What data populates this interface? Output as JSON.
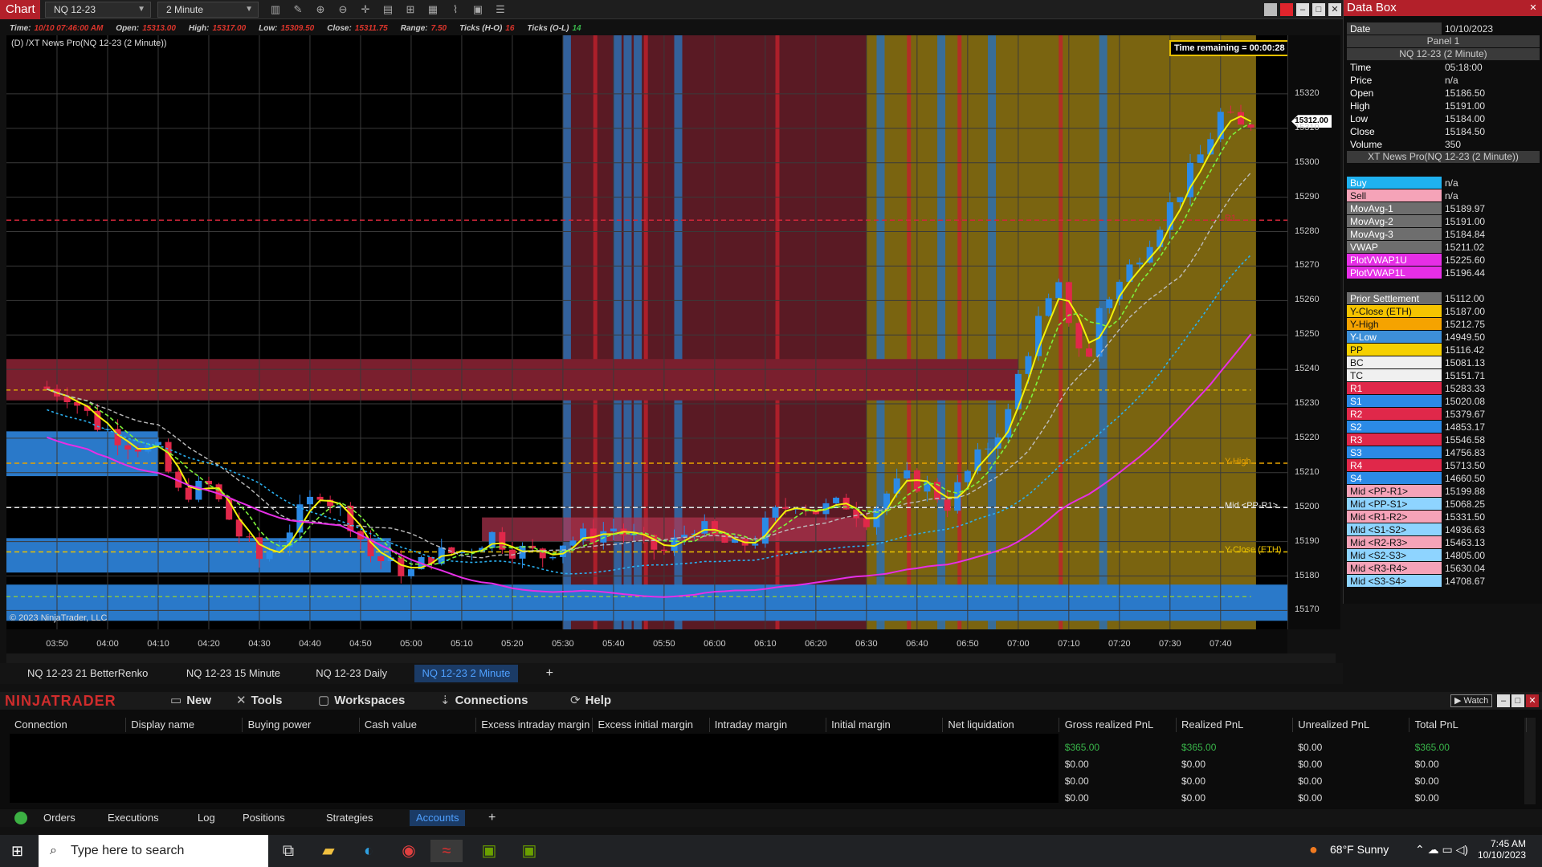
{
  "toolbar": {
    "chart_tag": "Chart",
    "instrument": "NQ 12-23",
    "interval": "2 Minute"
  },
  "infobar": {
    "items": [
      {
        "label": "Time:",
        "value": "10/10 07:46:00 AM",
        "cls": "ival"
      },
      {
        "label": "Open:",
        "value": "15313.00",
        "cls": "ival"
      },
      {
        "label": "High:",
        "value": "15317.00",
        "cls": "ival"
      },
      {
        "label": "Low:",
        "value": "15309.50",
        "cls": "ival"
      },
      {
        "label": "Close:",
        "value": "15311.75",
        "cls": "ival"
      },
      {
        "label": "Range:",
        "value": "7.50",
        "cls": "ival"
      },
      {
        "label": "Ticks (H-O)",
        "value": "16",
        "cls": "ival"
      },
      {
        "label": "Ticks (O-L)",
        "value": "14",
        "cls": "ival g"
      }
    ]
  },
  "chart": {
    "panel_name": "(D) /XT News Pro(NQ 12-23 (2 Minute))",
    "time_remaining": "Time remaining = 00:00:28",
    "copyright": "© 2023 NinjaTrader, LLC",
    "last_price": "15312.00",
    "level_labels": [
      {
        "text": "R1",
        "price": 15283.33,
        "color": "#d1273a"
      },
      {
        "text": "Y-High",
        "price": 15212.75,
        "color": "#e8a300"
      },
      {
        "text": "Mid <PP-R1>",
        "price": 15199.88,
        "color": "#e8e8e8"
      },
      {
        "text": "Y-Close (ETH)",
        "price": 15187.0,
        "color": "#e8c000"
      }
    ],
    "colors": {
      "buy_candle": "#2b8ae6",
      "sell_candle": "#e0284a",
      "zone_red": "#5a1a24",
      "zone_gold": "#7a6410",
      "zone_blue": "#2a79c9"
    }
  },
  "chart_data": {
    "type": "candlestick",
    "instrument": "NQ 12-23",
    "interval": "2 Minute",
    "x_ticks": [
      "03:50",
      "04:00",
      "04:10",
      "04:20",
      "04:30",
      "04:40",
      "04:50",
      "05:00",
      "05:10",
      "05:20",
      "05:30",
      "05:40",
      "05:50",
      "06:00",
      "06:10",
      "06:20",
      "06:30",
      "06:40",
      "06:50",
      "07:00",
      "07:10",
      "07:20",
      "07:30",
      "07:40"
    ],
    "y_ticks": [
      15320,
      15310,
      15300,
      15290,
      15280,
      15270,
      15260,
      15250,
      15240,
      15230,
      15220,
      15210,
      15200,
      15190,
      15180,
      15170
    ],
    "ylim": [
      15164.5,
      15337
    ],
    "close_path": [
      [
        "03:46",
        15235
      ],
      [
        "03:52",
        15233
      ],
      [
        "03:58",
        15224
      ],
      [
        "04:04",
        15219
      ],
      [
        "04:10",
        15216
      ],
      [
        "04:14",
        15204
      ],
      [
        "04:20",
        15206
      ],
      [
        "04:26",
        15192
      ],
      [
        "04:30",
        15185
      ],
      [
        "04:34",
        15190
      ],
      [
        "04:38",
        15198
      ],
      [
        "04:42",
        15205
      ],
      [
        "04:48",
        15196
      ],
      [
        "04:52",
        15186
      ],
      [
        "04:56",
        15183
      ],
      [
        "05:00",
        15181
      ],
      [
        "05:04",
        15186
      ],
      [
        "05:10",
        15187
      ],
      [
        "05:16",
        15192
      ],
      [
        "05:20",
        15188
      ],
      [
        "05:26",
        15186
      ],
      [
        "05:30",
        15190
      ],
      [
        "05:36",
        15192
      ],
      [
        "05:40",
        15194
      ],
      [
        "05:46",
        15189
      ],
      [
        "05:50",
        15187
      ],
      [
        "05:56",
        15195
      ],
      [
        "06:00",
        15191
      ],
      [
        "06:04",
        15188
      ],
      [
        "06:08",
        15191
      ],
      [
        "06:12",
        15198
      ],
      [
        "06:16",
        15202
      ],
      [
        "06:20",
        15199
      ],
      [
        "06:26",
        15201
      ],
      [
        "06:30",
        15197
      ],
      [
        "06:34",
        15204
      ],
      [
        "06:38",
        15208
      ],
      [
        "06:42",
        15206
      ],
      [
        "06:46",
        15201
      ],
      [
        "06:50",
        15210
      ],
      [
        "06:54",
        15218
      ],
      [
        "06:58",
        15227
      ],
      [
        "07:00",
        15238
      ],
      [
        "07:04",
        15254
      ],
      [
        "07:08",
        15263
      ],
      [
        "07:12",
        15247
      ],
      [
        "07:14",
        15243
      ],
      [
        "07:16",
        15258
      ],
      [
        "07:20",
        15265
      ],
      [
        "07:24",
        15274
      ],
      [
        "07:28",
        15283
      ],
      [
        "07:32",
        15292
      ],
      [
        "07:36",
        15302
      ],
      [
        "07:40",
        15314
      ],
      [
        "07:44",
        15310
      ],
      [
        "07:46",
        15311.75
      ]
    ]
  },
  "databox": {
    "title": "Data Box",
    "date_label": "Date",
    "date_value": "10/10/2023",
    "panel": "Panel 1",
    "series_title": "NQ 12-23 (2 Minute)",
    "ohlc": [
      {
        "l": "Time",
        "v": "05:18:00"
      },
      {
        "l": "Price",
        "v": "n/a"
      },
      {
        "l": "Open",
        "v": "15186.50"
      },
      {
        "l": "High",
        "v": "15191.00"
      },
      {
        "l": "Low",
        "v": "15184.00"
      },
      {
        "l": "Close",
        "v": "15184.50"
      },
      {
        "l": "Volume",
        "v": "350"
      }
    ],
    "indicator_title": "XT News Pro(NQ 12-23 (2 Minute))",
    "indicators": [
      {
        "l": "Buy",
        "v": "n/a",
        "c": "#1fb1f0"
      },
      {
        "l": "Sell",
        "v": "n/a",
        "c": "#f5a3b8"
      },
      {
        "l": "MovAvg-1",
        "v": "15189.97",
        "c": "#6e6e6e"
      },
      {
        "l": "MovAvg-2",
        "v": "15191.00",
        "c": "#6e6e6e"
      },
      {
        "l": "MovAvg-3",
        "v": "15184.84",
        "c": "#6e6e6e"
      },
      {
        "l": "VWAP",
        "v": "15211.02",
        "c": "#6e6e6e"
      },
      {
        "l": "PlotVWAP1U",
        "v": "15225.60",
        "c": "#e62ee6"
      },
      {
        "l": "PlotVWAP1L",
        "v": "15196.44",
        "c": "#e62ee6"
      }
    ],
    "levels": [
      {
        "l": "Prior Settlement",
        "v": "15112.00",
        "c": "#6e6e6e"
      },
      {
        "l": "Y-Close (ETH)",
        "v": "15187.00",
        "c": "#f5c400"
      },
      {
        "l": "Y-High",
        "v": "15212.75",
        "c": "#f5a300"
      },
      {
        "l": "Y-Low",
        "v": "14949.50",
        "c": "#3d8fd8"
      },
      {
        "l": "PP",
        "v": "15116.42",
        "c": "#f5d000"
      },
      {
        "l": "BC",
        "v": "15081.13",
        "c": "#f0f0f0"
      },
      {
        "l": "TC",
        "v": "15151.71",
        "c": "#f0f0f0"
      },
      {
        "l": "R1",
        "v": "15283.33",
        "c": "#e0284a"
      },
      {
        "l": "S1",
        "v": "15020.08",
        "c": "#2b8ae6"
      },
      {
        "l": "R2",
        "v": "15379.67",
        "c": "#e0284a"
      },
      {
        "l": "S2",
        "v": "14853.17",
        "c": "#2b8ae6"
      },
      {
        "l": "R3",
        "v": "15546.58",
        "c": "#e0284a"
      },
      {
        "l": "S3",
        "v": "14756.83",
        "c": "#2b8ae6"
      },
      {
        "l": "R4",
        "v": "15713.50",
        "c": "#e0284a"
      },
      {
        "l": "S4",
        "v": "14660.50",
        "c": "#2b8ae6"
      },
      {
        "l": "Mid <PP-R1>",
        "v": "15199.88",
        "c": "#f5a3b8"
      },
      {
        "l": "Mid <PP-S1>",
        "v": "15068.25",
        "c": "#8ed4ff"
      },
      {
        "l": "Mid <R1-R2>",
        "v": "15331.50",
        "c": "#f5a3b8"
      },
      {
        "l": "Mid <S1-S2>",
        "v": "14936.63",
        "c": "#8ed4ff"
      },
      {
        "l": "Mid <R2-R3>",
        "v": "15463.13",
        "c": "#f5a3b8"
      },
      {
        "l": "Mid <S2-S3>",
        "v": "14805.00",
        "c": "#8ed4ff"
      },
      {
        "l": "Mid <R3-R4>",
        "v": "15630.04",
        "c": "#f5a3b8"
      },
      {
        "l": "Mid <S3-S4>",
        "v": "14708.67",
        "c": "#8ed4ff"
      }
    ]
  },
  "chart_tabs": [
    "NQ 12-23 21 BetterRenko",
    "NQ 12-23 15 Minute",
    "NQ 12-23 Daily",
    "NQ 12-23 2 Minute"
  ],
  "active_chart_tab": "NQ 12-23 2 Minute",
  "nt": {
    "logo": "NINJATRADER",
    "menu": [
      "New",
      "Tools",
      "Workspaces",
      "Connections",
      "Help"
    ],
    "watch": "Watch"
  },
  "accounts": {
    "columns": [
      "Connection",
      "Display name",
      "Buying power",
      "Cash value",
      "Excess intraday margin",
      "Excess initial margin",
      "Intraday margin",
      "Initial margin",
      "Net liquidation",
      "Gross realized PnL",
      "Realized PnL",
      "Unrealized PnL",
      "Total PnL"
    ],
    "rows": [
      [
        "$365.00",
        "$365.00",
        "$0.00",
        "$365.00"
      ],
      [
        "$0.00",
        "$0.00",
        "$0.00",
        "$0.00"
      ],
      [
        "$0.00",
        "$0.00",
        "$0.00",
        "$0.00"
      ],
      [
        "$0.00",
        "$0.00",
        "$0.00",
        "$0.00"
      ]
    ]
  },
  "bottom_tabs": [
    "Orders",
    "Executions",
    "Log",
    "Positions",
    "Strategies",
    "Accounts"
  ],
  "active_bottom_tab": "Accounts",
  "taskbar": {
    "search_placeholder": "Type here to search",
    "weather": "68°F  Sunny",
    "time": "7:45 AM",
    "date": "10/10/2023"
  }
}
